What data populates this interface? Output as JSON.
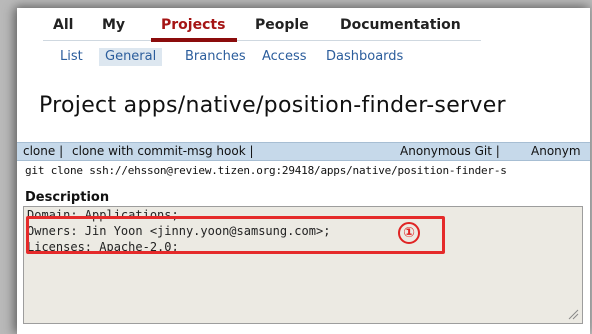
{
  "top_menu": {
    "all": "All",
    "my": "My",
    "projects": "Projects",
    "people": "People",
    "documentation": "Documentation"
  },
  "sub_menu": {
    "list": "List",
    "general": "General",
    "branches": "Branches",
    "access": "Access",
    "dashboards": "Dashboards"
  },
  "project": {
    "title": "Project apps/native/position-finder-server"
  },
  "clone": {
    "clone_label": "clone |",
    "clone_hook_label": "clone with commit-msg hook |",
    "anon_git": "Anonymous Git |",
    "anon_http": "Anonym",
    "command": "git clone ssh://ehsson@review.tizen.org:29418/apps/native/position-finder-s"
  },
  "description": {
    "heading": "Description",
    "lines": [
      "Domain: Applications;",
      "Owners: Jin Yoon <jinny.yoon@samsung.com>;",
      "Licenses: Apache-2.0;"
    ]
  },
  "annotation": {
    "number": "①",
    "color": "#e52a2a"
  },
  "colors": {
    "active_tab": "#a51414",
    "link": "#2b5d9c",
    "clone_bar": "#c6d9ea",
    "textarea_bg": "#eceae3"
  }
}
